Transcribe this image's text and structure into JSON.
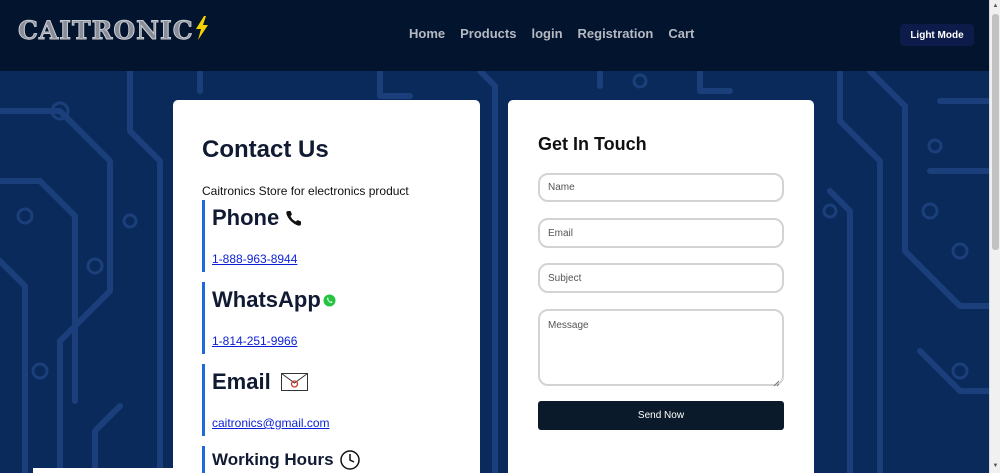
{
  "brand": {
    "name": "CAITRONIC"
  },
  "nav": {
    "links": [
      "Home",
      "Products",
      "login",
      "Registration",
      "Cart"
    ],
    "mode_button": "Light Mode"
  },
  "contact": {
    "title": "Contact Us",
    "description": "Caitronics Store for electronics product",
    "phone": {
      "label": "Phone",
      "value": "1-888-963-8944",
      "icon": "phone-icon"
    },
    "whatsapp": {
      "label": "WhatsApp",
      "value": "1-814-251-9966",
      "icon": "whatsapp-icon"
    },
    "email": {
      "label": "Email",
      "value": "caitronics@gmail.com",
      "icon": "envelope-icon"
    },
    "hours": {
      "label": "Working Hours",
      "icon": "clock-icon"
    }
  },
  "form": {
    "title": "Get In Touch",
    "name_placeholder": "Name",
    "email_placeholder": "Email",
    "subject_placeholder": "Subject",
    "message_placeholder": "Message",
    "submit_label": "Send Now"
  },
  "colors": {
    "navbar": "#03142e",
    "background": "#0b2a5c",
    "accent": "#1e6ad8",
    "button": "#0b1a2a",
    "bolt": "#f5d200"
  }
}
